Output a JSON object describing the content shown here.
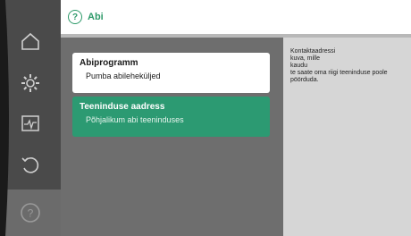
{
  "header": {
    "title": "Abi"
  },
  "sidebar": {
    "items": [
      {
        "icon": "home-icon"
      },
      {
        "icon": "gear-icon"
      },
      {
        "icon": "pulse-icon"
      },
      {
        "icon": "undo-icon"
      },
      {
        "icon": "help-icon"
      }
    ]
  },
  "cards": [
    {
      "title": "Abiprogramm",
      "subtitle": "Pumba abileheküljed"
    },
    {
      "title": "Teeninduse aadress",
      "subtitle": "Põhjalikum abi teeninduses"
    }
  ],
  "info": {
    "lines": [
      "Kontaktaadressi",
      "kuva, mille",
      "kaudu",
      "te saate oma riigi teeninduse poole",
      "pöörduda."
    ]
  },
  "colors": {
    "accent": "#2c9a72",
    "sidebar": "#4a4a4a",
    "main": "#6e6e6e",
    "panel": "#d6d6d6"
  }
}
